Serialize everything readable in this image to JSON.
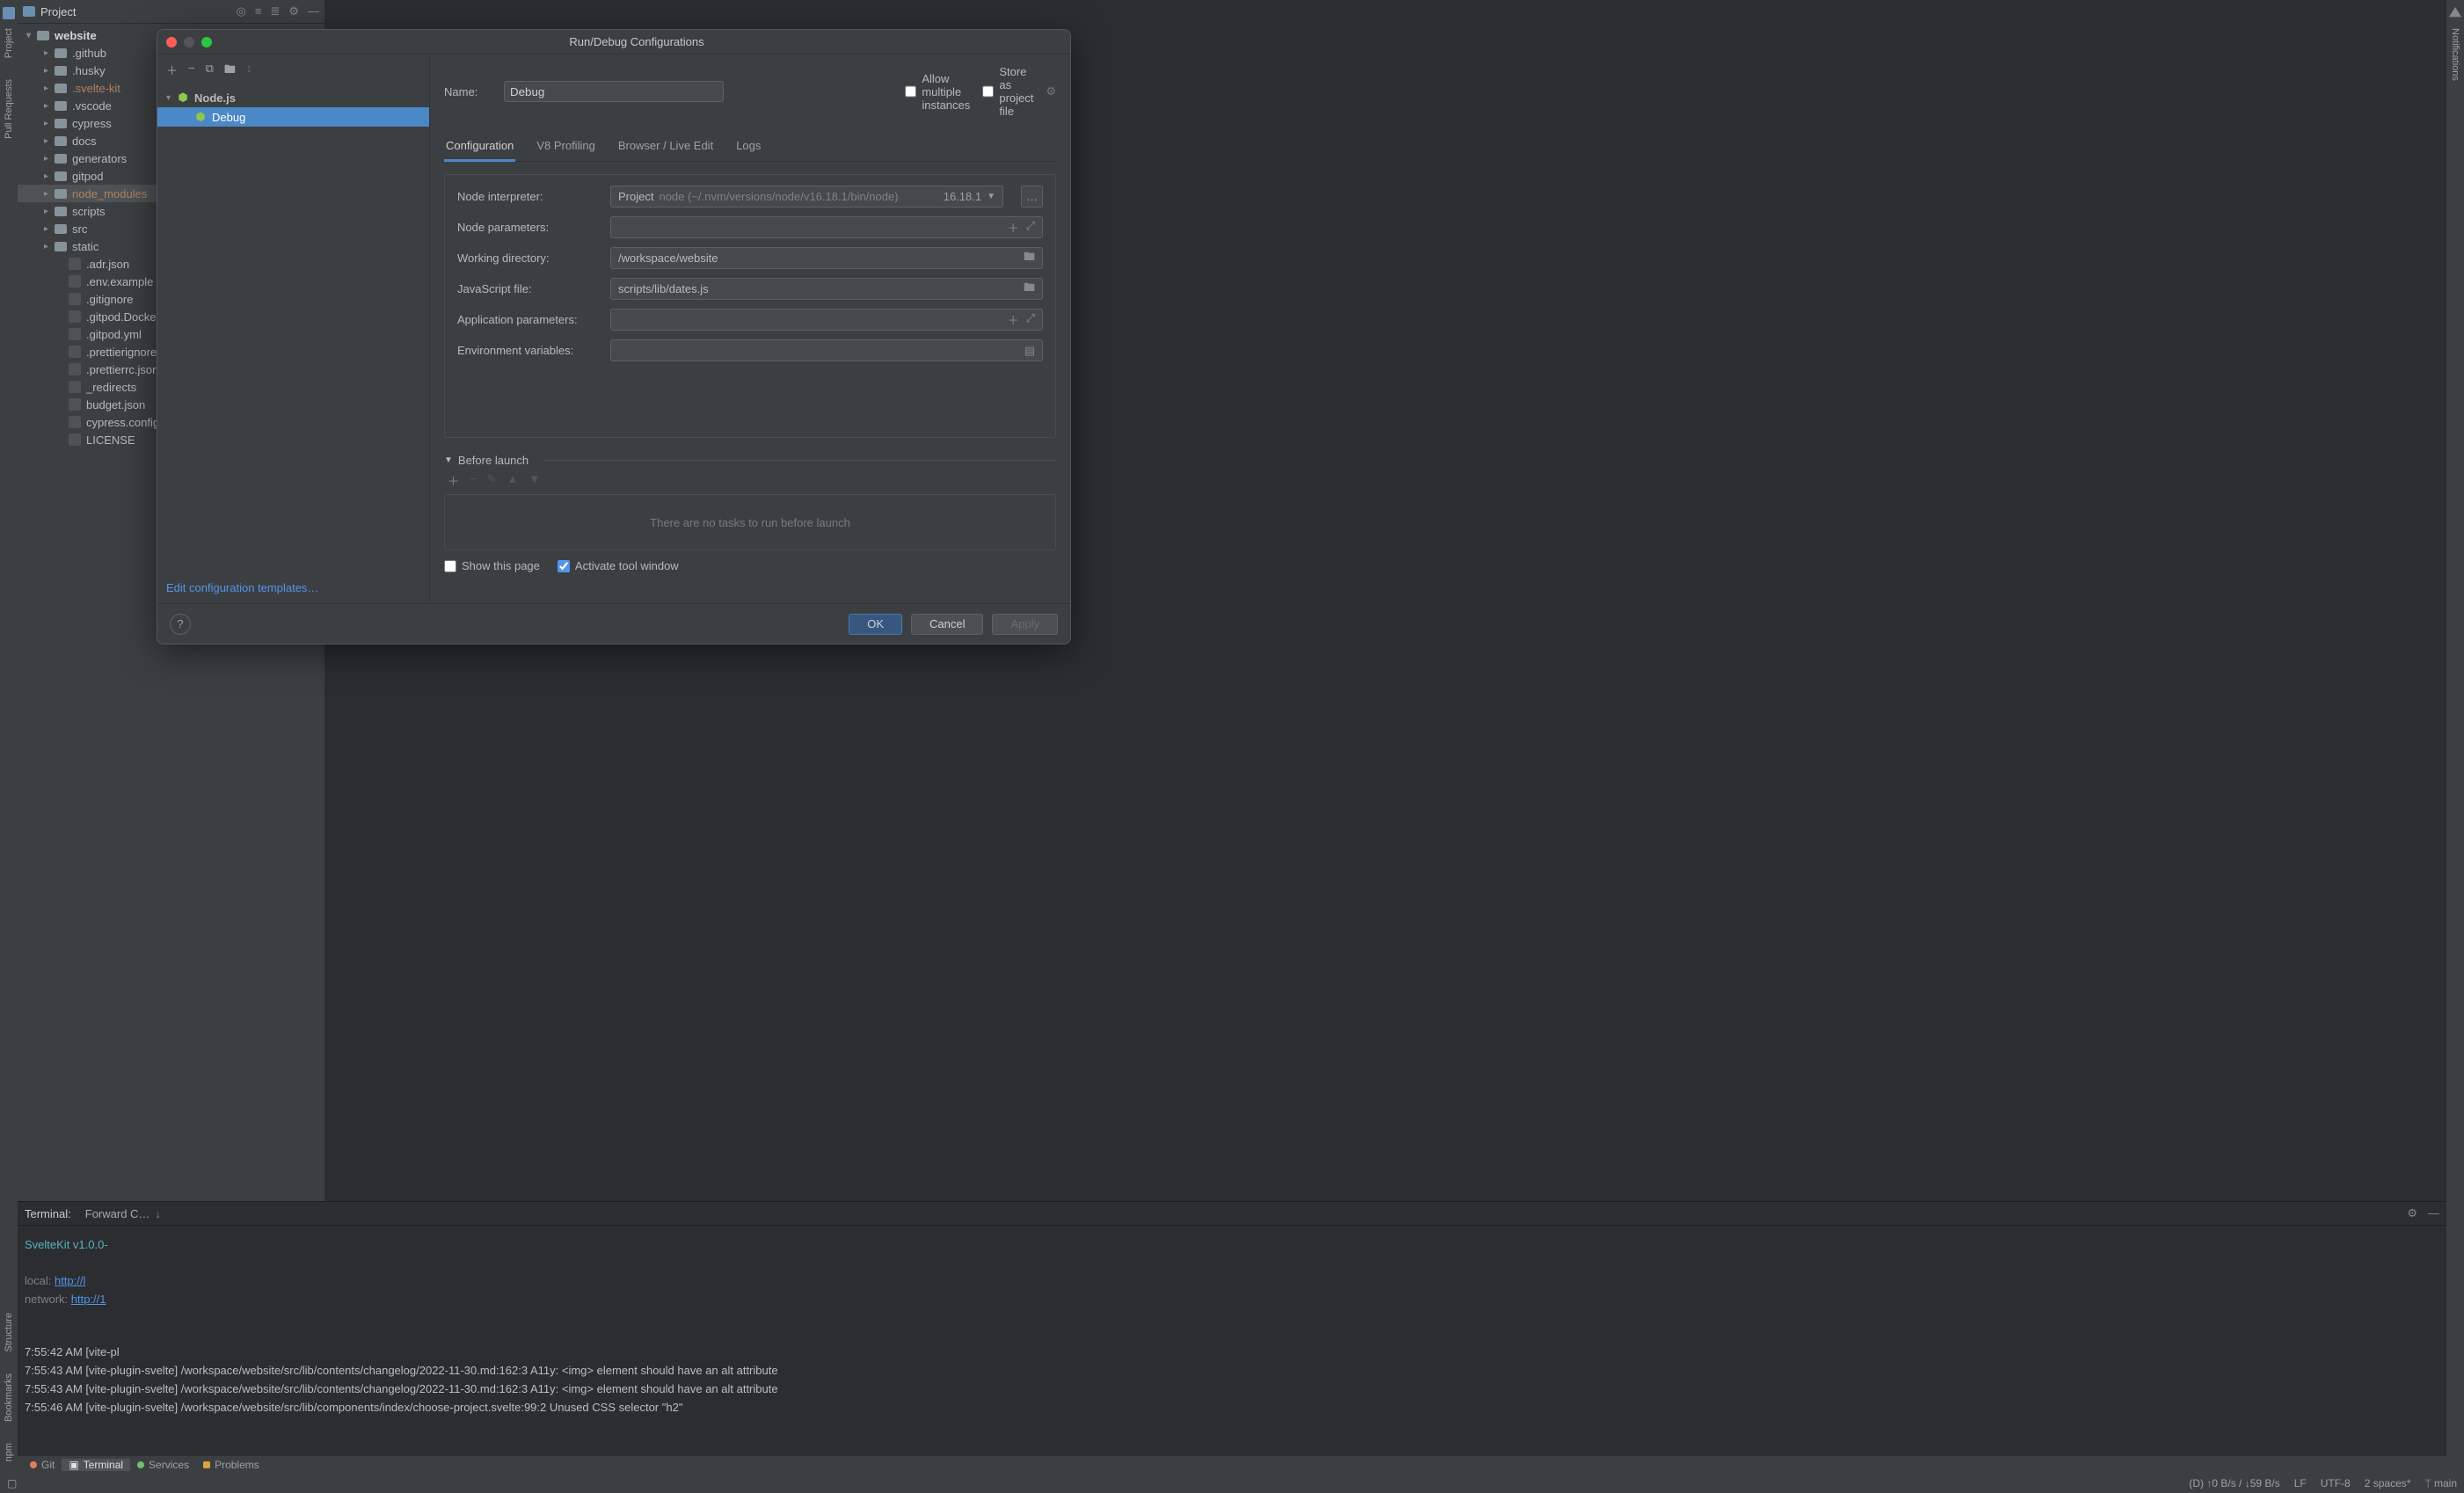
{
  "project_panel": {
    "title": "Project",
    "root": "website",
    "folders": [
      ".github",
      ".husky",
      ".svelte-kit",
      ".vscode",
      "cypress",
      "docs",
      "generators",
      "gitpod",
      "node_modules",
      "scripts",
      "src",
      "static"
    ],
    "files": [
      ".adr.json",
      ".env.example",
      ".gitignore",
      ".gitpod.Dockerfile",
      ".gitpod.yml",
      ".prettierignore",
      ".prettierrc.json",
      "_redirects",
      "budget.json",
      "cypress.config.ts",
      "LICENSE"
    ]
  },
  "terminal": {
    "label": "Terminal:",
    "tab": "Forward C…",
    "lines": {
      "l0": "SvelteKit v1.0.0-",
      "l1a": "local:   ",
      "l1b": "http://l",
      "l2a": "network: ",
      "l2b": "http://1",
      "l3": "7:55:42 AM [vite-pl",
      "l4": "7:55:43 AM [vite-plugin-svelte] /workspace/website/src/lib/contents/changelog/2022-11-30.md:162:3 A11y: <img> element should have an alt attribute",
      "l5": "7:55:43 AM [vite-plugin-svelte] /workspace/website/src/lib/contents/changelog/2022-11-30.md:162:3 A11y: <img> element should have an alt attribute",
      "l6": "7:55:46 AM [vite-plugin-svelte] /workspace/website/src/lib/components/index/choose-project.svelte:99:2 Unused CSS selector \"h2\""
    }
  },
  "bottom_tools": {
    "git": "Git",
    "terminal": "Terminal",
    "services": "Services",
    "problems": "Problems"
  },
  "left_vbar": {
    "project": "Project",
    "pull_requests": "Pull Requests",
    "structure": "Structure",
    "bookmarks": "Bookmarks",
    "npm": "npm"
  },
  "right_vbar": {
    "notifications": "Notifications"
  },
  "status": {
    "net": "(D) ↑0 B/s / ↓59 B/s",
    "le": "LF",
    "enc": "UTF-8",
    "indent": "2 spaces*",
    "branch": "main"
  },
  "dialog": {
    "title": "Run/Debug Configurations",
    "tree": {
      "group": "Node.js",
      "item": "Debug"
    },
    "edit_templates": "Edit configuration templates…",
    "name_label": "Name:",
    "name_value": "Debug",
    "allow_multiple": "Allow multiple instances",
    "store_as": "Store as project file",
    "tabs": {
      "configuration": "Configuration",
      "v8": "V8 Profiling",
      "browser": "Browser / Live Edit",
      "logs": "Logs"
    },
    "fields": {
      "node_interpreter": {
        "label": "Node interpreter:",
        "prefix": "Project",
        "path": "node (~/.nvm/versions/node/v16.18.1/bin/node)",
        "version": "16.18.1"
      },
      "node_parameters": {
        "label": "Node parameters:",
        "value": ""
      },
      "working_dir": {
        "label": "Working directory:",
        "value": "/workspace/website"
      },
      "js_file": {
        "label": "JavaScript file:",
        "value": "scripts/lib/dates.js"
      },
      "app_params": {
        "label": "Application parameters:",
        "value": ""
      },
      "env_vars": {
        "label": "Environment variables:",
        "value": ""
      }
    },
    "before_launch": {
      "title": "Before launch",
      "empty": "There are no tasks to run before launch"
    },
    "show_this_page": "Show this page",
    "activate_tool": "Activate tool window",
    "buttons": {
      "ok": "OK",
      "cancel": "Cancel",
      "apply": "Apply"
    }
  }
}
